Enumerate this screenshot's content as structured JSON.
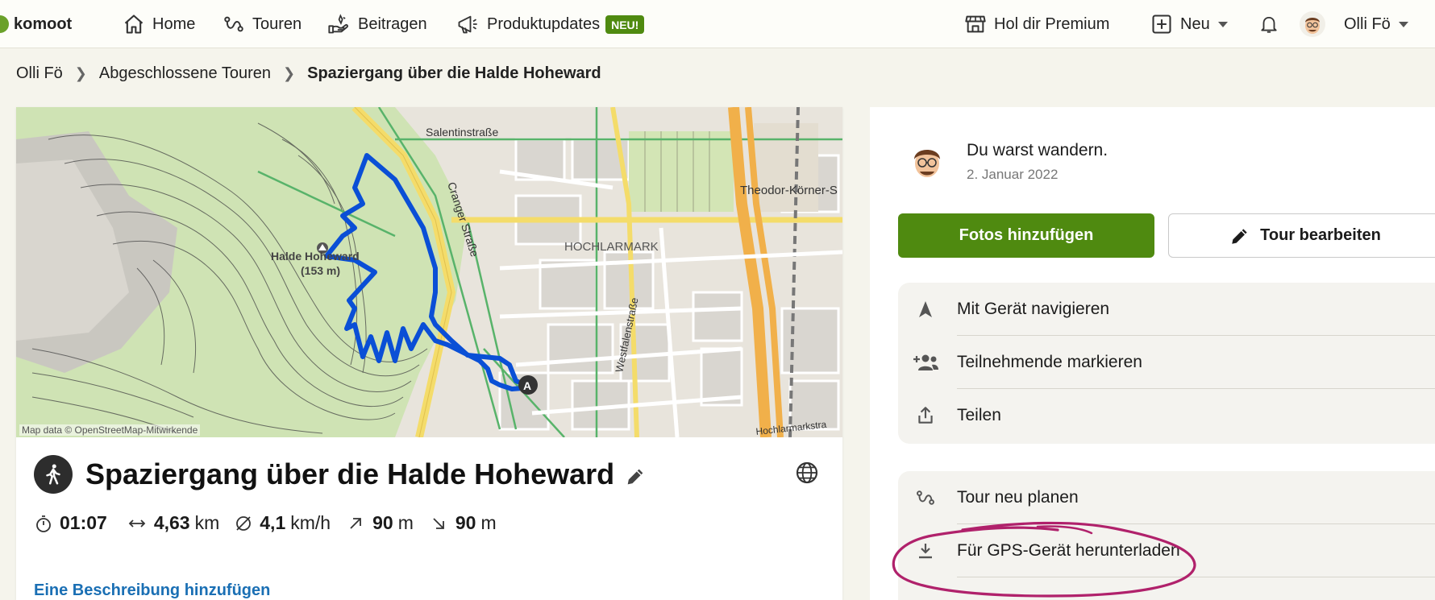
{
  "nav": {
    "logo": "komoot",
    "home": "Home",
    "tours": "Touren",
    "contribute": "Beitragen",
    "updates": "Produktupdates",
    "updates_badge": "NEU!",
    "premium": "Hol dir Premium",
    "new": "Neu",
    "user": "Olli Fö"
  },
  "breadcrumb": {
    "user": "Olli Fö",
    "section": "Abgeschlossene Touren",
    "current": "Spaziergang über die Halde Hoheward"
  },
  "map": {
    "attribution": "Map data © OpenStreetMap-Mitwirkende",
    "labels": {
      "salentin": "Salentinstraße",
      "cranger": "Cranger Straße",
      "hochlarmark": "HOCHLARMARK",
      "halde": "Halde Hoheward",
      "halde_height": "(153 m)",
      "westfalen": "Westfalenstraße",
      "theodor": "Theodor-Körner-S",
      "hochlarmarkstr": "Hochlarmarkstra",
      "start_marker": "A"
    },
    "colors": {
      "route": "#0a4fd6",
      "forest": "#cfe3b4",
      "road_yellow": "#f4dc6a",
      "road_orange": "#f1b04a"
    }
  },
  "tour": {
    "title": "Spaziergang über die Halde Hoheward",
    "stats": {
      "duration": "01:07",
      "distance": "4,63",
      "distance_unit": "km",
      "speed": "4,1",
      "speed_unit": "km/h",
      "up": "90",
      "up_unit": "m",
      "down": "90",
      "down_unit": "m"
    },
    "cut_link": "Eine Beschreibung hinzufügen"
  },
  "activity": {
    "text": "Du warst wandern.",
    "date": "2. Januar 2022"
  },
  "buttons": {
    "add_photos": "Fotos hinzufügen",
    "edit_tour": "Tour bearbeiten"
  },
  "actions": {
    "navigate": "Mit Gerät navigieren",
    "tag_participants": "Teilnehmende markieren",
    "share": "Teilen",
    "replan": "Tour neu planen",
    "download_gps": "Für GPS-Gerät herunterladen"
  },
  "theme": {
    "primary": "#4f8a10",
    "annotation": "#b0216b"
  }
}
